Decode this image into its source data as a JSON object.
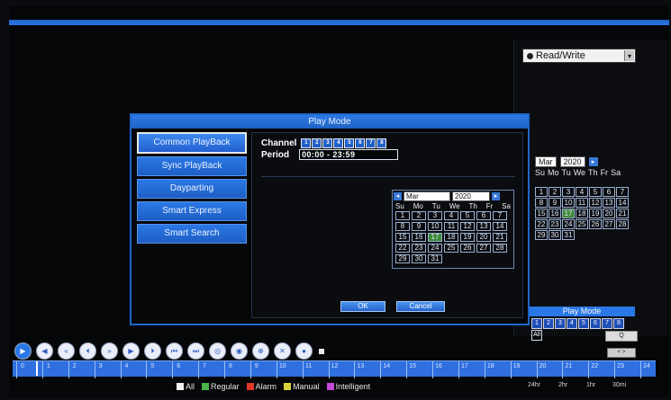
{
  "right_panel": {
    "mode_select": "Read/Write",
    "calendar": {
      "month": "Mar",
      "year": "2020",
      "weekdays": [
        "Su",
        "Mo",
        "Tu",
        "We",
        "Th",
        "Fr",
        "Sa"
      ],
      "days": [
        "",
        "",
        "",
        "",
        "",
        "",
        "",
        "1",
        "2",
        "3",
        "4",
        "5",
        "6",
        "7",
        "8",
        "9",
        "10",
        "11",
        "12",
        "13",
        "14",
        "15",
        "16",
        "17",
        "18",
        "19",
        "20",
        "21",
        "22",
        "23",
        "24",
        "25",
        "26",
        "27",
        "28",
        "29",
        "30",
        "31"
      ],
      "highlight_day": "17"
    },
    "play_mode_label": "Play Mode",
    "channels": [
      "1",
      "2",
      "3",
      "4",
      "5",
      "6",
      "7",
      "8"
    ],
    "all_label": "All",
    "search_label": "Q",
    "small_button": "< >"
  },
  "dialog": {
    "title": "Play Mode",
    "menu": [
      {
        "label": "Common PlayBack",
        "active": true
      },
      {
        "label": "Sync PlayBack",
        "active": false
      },
      {
        "label": "Dayparting",
        "active": false
      },
      {
        "label": "Smart Express",
        "active": false
      },
      {
        "label": "Smart Search",
        "active": false
      }
    ],
    "channel_label": "Channel",
    "channels": [
      "1",
      "2",
      "3",
      "4",
      "5",
      "6",
      "7",
      "8"
    ],
    "period_label": "Period",
    "period_value": "00:00  -  23:59",
    "calendar": {
      "month": "Mar",
      "year": "2020",
      "weekdays": [
        "Su",
        "Mo",
        "Tu",
        "We",
        "Th",
        "Fr",
        "Sa"
      ],
      "days": [
        "1",
        "2",
        "3",
        "4",
        "5",
        "6",
        "7",
        "8",
        "9",
        "10",
        "11",
        "12",
        "13",
        "14",
        "15",
        "16",
        "17",
        "18",
        "19",
        "20",
        "21",
        "22",
        "23",
        "24",
        "25",
        "26",
        "27",
        "28",
        "29",
        "30",
        "31"
      ],
      "highlight_day": "17"
    },
    "ok_label": "OK",
    "cancel_label": "Cancel"
  },
  "toolbar": {
    "buttons": [
      "play",
      "prev",
      "rewind",
      "step-back",
      "fast-forward",
      "next",
      "step-forward",
      "skip-back",
      "skip-forward",
      "slow",
      "snapshot",
      "zoom",
      "cancel",
      "record"
    ]
  },
  "timeline": {
    "ticks": [
      "0",
      "1",
      "2",
      "3",
      "4",
      "5",
      "6",
      "7",
      "8",
      "9",
      "10",
      "11",
      "12",
      "13",
      "14",
      "15",
      "16",
      "17",
      "18",
      "19",
      "20",
      "21",
      "22",
      "23",
      "24"
    ]
  },
  "legend": {
    "items": [
      {
        "label": "All",
        "color": "#f0f0f0"
      },
      {
        "label": "Regular",
        "color": "#49b34a"
      },
      {
        "label": "Alarm",
        "color": "#e2372b"
      },
      {
        "label": "Manual",
        "color": "#d9d13a"
      },
      {
        "label": "Intelligent",
        "color": "#c34bd6"
      }
    ],
    "zoom_levels": [
      "24hr",
      "2hr",
      "1hr",
      "30mi"
    ]
  }
}
